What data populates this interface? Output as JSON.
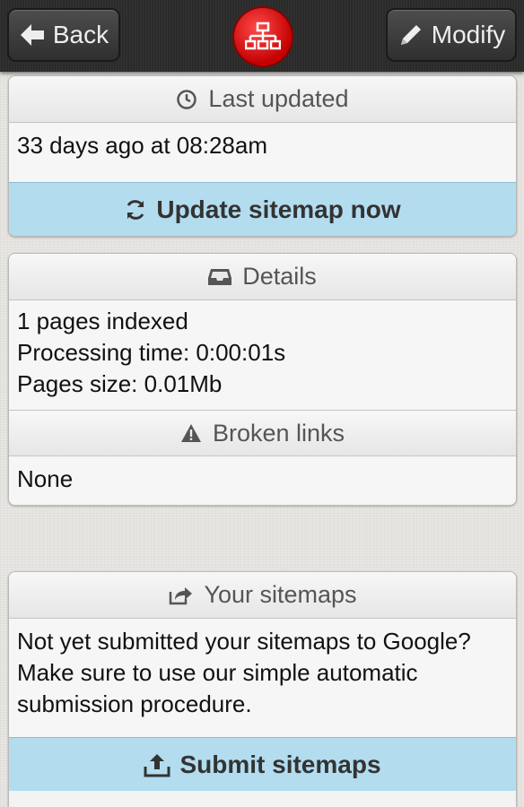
{
  "topbar": {
    "back_label": "Back",
    "modify_label": "Modify",
    "logo_icon": "sitemap-icon",
    "logo_color": "#d40000"
  },
  "last_updated": {
    "title": "Last updated",
    "value": "33 days ago at 08:28am",
    "action_label": "Update sitemap now"
  },
  "details": {
    "title": "Details",
    "lines": [
      "1 pages indexed",
      "Processing time: 0:00:01s",
      "Pages size: 0.01Mb"
    ],
    "broken_links_title": "Broken links",
    "broken_links_value": "None"
  },
  "your_sitemaps": {
    "title": "Your sitemaps",
    "text": "Not yet submitted your sitemaps to Google? Make sure to use our simple automatic submission procedure.",
    "action_label": "Submit sitemaps"
  },
  "colors": {
    "action_bg": "#b3dcef",
    "topbar_bg": "#2b2b2b"
  }
}
